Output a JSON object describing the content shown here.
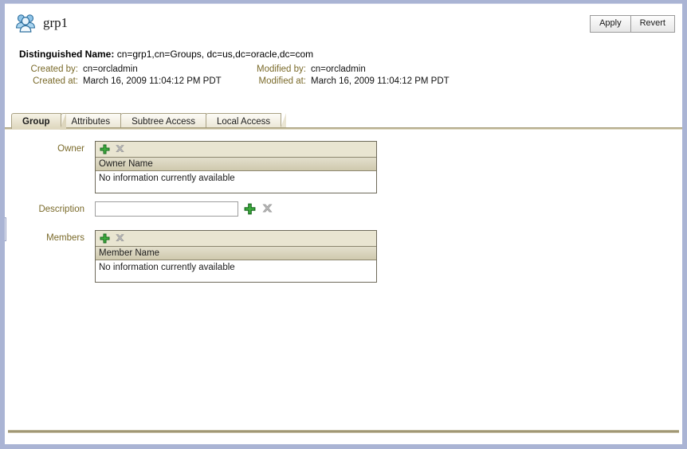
{
  "window": {
    "collapse_handle": "collapse-left-panel"
  },
  "header": {
    "icon": "group-icon",
    "title": "grp1",
    "buttons": [
      {
        "label": "Apply",
        "name": "apply-button"
      },
      {
        "label": "Revert",
        "name": "revert-button"
      }
    ]
  },
  "meta": {
    "dn_label": "Distinguished Name:",
    "dn_value": "cn=grp1,cn=Groups, dc=us,dc=oracle,dc=com",
    "created_by_label": "Created by:",
    "created_by_value": "cn=orcladmin",
    "created_at_label": "Created at:",
    "created_at_value": "March 16, 2009 11:04:12 PM PDT",
    "modified_by_label": "Modified by:",
    "modified_by_value": "cn=orcladmin",
    "modified_at_label": "Modified at:",
    "modified_at_value": "March 16, 2009 11:04:12 PM PDT"
  },
  "tabs": [
    {
      "label": "Group",
      "active": true
    },
    {
      "label": "Attributes",
      "active": false
    },
    {
      "label": "Subtree Access",
      "active": false
    },
    {
      "label": "Local Access",
      "active": false
    }
  ],
  "form": {
    "owner": {
      "label": "Owner",
      "add_icon": "add-icon",
      "delete_icon": "delete-icon",
      "column_header": "Owner Name",
      "empty_message": "No information currently available"
    },
    "description": {
      "label": "Description",
      "value": "",
      "placeholder": "",
      "add_icon": "add-icon",
      "delete_icon": "delete-icon"
    },
    "members": {
      "label": "Members",
      "add_icon": "add-icon",
      "delete_icon": "delete-icon",
      "column_header": "Member Name",
      "empty_message": "No information currently available"
    }
  },
  "colors": {
    "window_border": "#aab4d4",
    "label_olive": "#7a6a2a",
    "toolbar_beige": "#e9e5d1",
    "rule_tan": "#8e8560",
    "add_green": "#2f9e2f",
    "delete_gray": "#a8a8a8"
  }
}
